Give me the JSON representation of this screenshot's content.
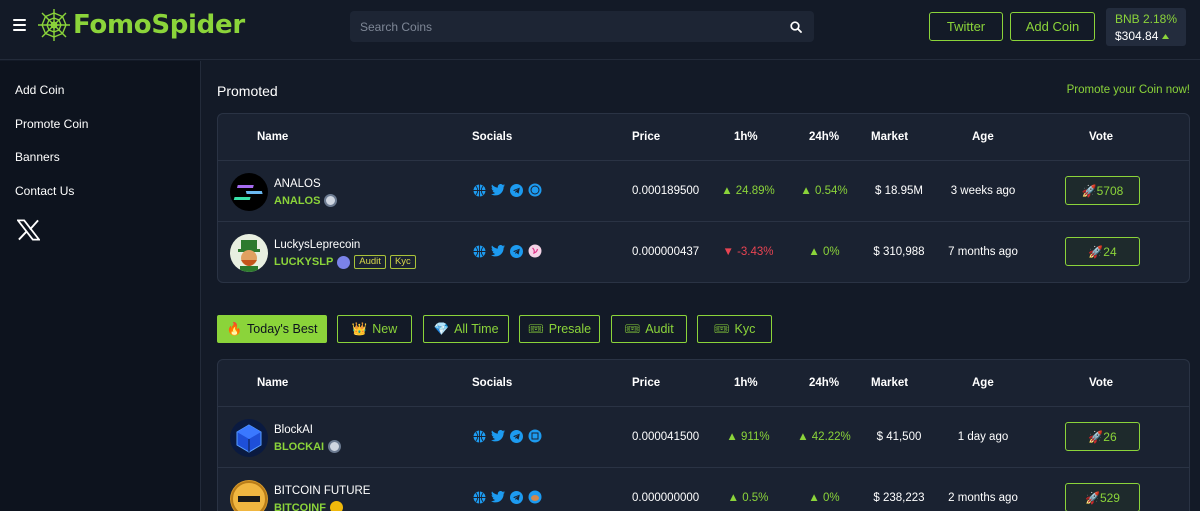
{
  "header": {
    "logo_text": "FomoSpider",
    "search_placeholder": "Search Coins",
    "twitter_label": "Twitter",
    "add_coin_label": "Add Coin",
    "bnb": {
      "symbol": "BNB",
      "change": "2.18%",
      "price": "$304.84"
    }
  },
  "sidebar": {
    "items": [
      {
        "label": "Add Coin"
      },
      {
        "label": "Promote Coin"
      },
      {
        "label": "Banners"
      },
      {
        "label": "Contact Us"
      }
    ]
  },
  "promoted": {
    "title": "Promoted",
    "promote_link": "Promote your Coin now!"
  },
  "columns": [
    "Name",
    "Socials",
    "Price",
    "1h%",
    "24h%",
    "Market",
    "Age",
    "Vote"
  ],
  "promoted_rows": [
    {
      "name": "ANALOS",
      "symbol": "ANALOS",
      "tags": [],
      "price": "0.000189500",
      "h1": "24.89%",
      "h1_dir": "up",
      "h24": "0.54%",
      "h24_dir": "up",
      "market": "$ 18.95M",
      "age": "3 weeks ago",
      "votes": "5708"
    },
    {
      "name": "LuckysLeprecoin",
      "symbol": "LUCKYSLP",
      "tags": [
        "Audit",
        "Kyc"
      ],
      "price": "0.000000437",
      "h1": "-3.43%",
      "h1_dir": "down",
      "h24": "0%",
      "h24_dir": "up",
      "market": "$ 310,988",
      "age": "7 months ago",
      "votes": "24"
    }
  ],
  "filters": [
    {
      "label": "Today's Best",
      "icon": "fire-icon",
      "active": true
    },
    {
      "label": "New",
      "icon": "crown-icon",
      "active": false
    },
    {
      "label": "All Time",
      "icon": "diamond-icon",
      "active": false
    },
    {
      "label": "Presale",
      "icon": "ticket-icon",
      "active": false
    },
    {
      "label": "Audit",
      "icon": "ticket-icon",
      "active": false
    },
    {
      "label": "Kyc",
      "icon": "ticket-icon",
      "active": false
    }
  ],
  "best_rows": [
    {
      "name": "BlockAI",
      "symbol": "BLOCKAI",
      "price": "0.000041500",
      "h1": "911%",
      "h1_dir": "up",
      "h24": "42.22%",
      "h24_dir": "up",
      "market": "$ 41,500",
      "age": "1 day ago",
      "votes": "26"
    },
    {
      "name": "BITCOIN FUTURE",
      "symbol": "BITCOINF",
      "price": "0.000000000",
      "h1": "0.5%",
      "h1_dir": "up",
      "h24": "0%",
      "h24_dir": "up",
      "market": "$ 238,223",
      "age": "2 months ago",
      "votes": "529"
    }
  ],
  "colors": {
    "accent": "#8bd43a",
    "negative": "#e84452",
    "background": "#131a27",
    "sidebar": "#0d131e",
    "panel": "#1a2231"
  }
}
